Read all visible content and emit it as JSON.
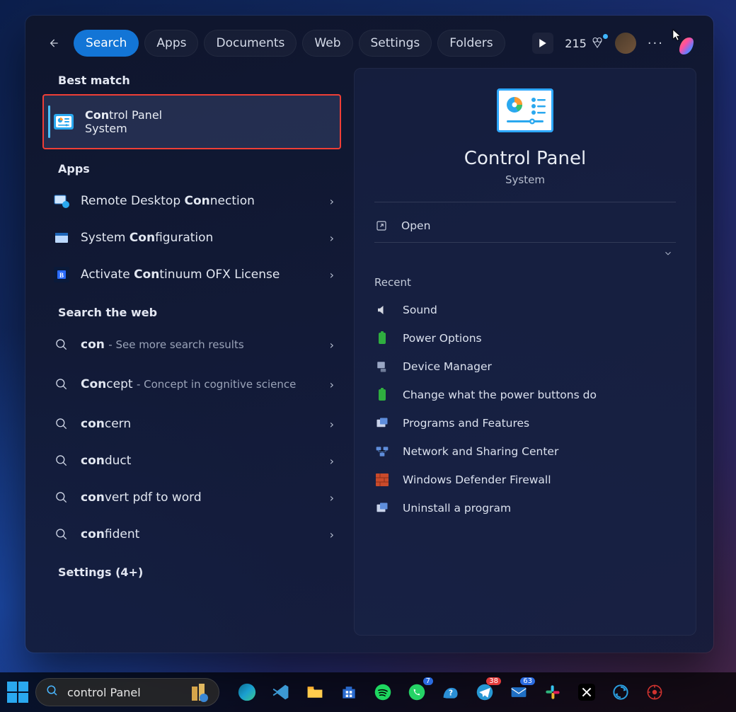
{
  "tabs": [
    "Search",
    "Apps",
    "Documents",
    "Web",
    "Settings",
    "Folders"
  ],
  "points": "215",
  "sections": {
    "best": "Best match",
    "apps": "Apps",
    "web": "Search the web",
    "settings": "Settings (4+)"
  },
  "best": {
    "title": "Control Panel",
    "title_pre": "Con",
    "title_rest": "trol Panel",
    "sub": "System"
  },
  "apps": [
    {
      "pre": "Remote Desktop ",
      "bold": "Con",
      "post": "nection"
    },
    {
      "pre": "System ",
      "bold": "Con",
      "post": "figuration"
    },
    {
      "pre": "Activate ",
      "bold": "Con",
      "post": "tinuum OFX License"
    }
  ],
  "web": [
    {
      "q": "con",
      "desc": "See more search results",
      "two": false
    },
    {
      "q": "Concept",
      "desc": "Concept in cognitive science",
      "two": true
    },
    {
      "q": "concern",
      "desc": "",
      "two": false
    },
    {
      "q": "conduct",
      "desc": "",
      "two": false
    },
    {
      "q": "convert pdf to word",
      "desc": "",
      "two": false
    },
    {
      "q": "confident",
      "desc": "",
      "two": false
    }
  ],
  "preview": {
    "title": "Control Panel",
    "category": "System",
    "open": "Open",
    "recent_label": "Recent",
    "recent": [
      "Sound",
      "Power Options",
      "Device Manager",
      "Change what the power buttons do",
      "Programs and Features",
      "Network and Sharing Center",
      "Windows Defender Firewall",
      "Uninstall a program"
    ]
  },
  "taskbar": {
    "search": "control Panel",
    "badges": {
      "whatsapp": "7",
      "chat": "38",
      "mail": "63"
    }
  }
}
